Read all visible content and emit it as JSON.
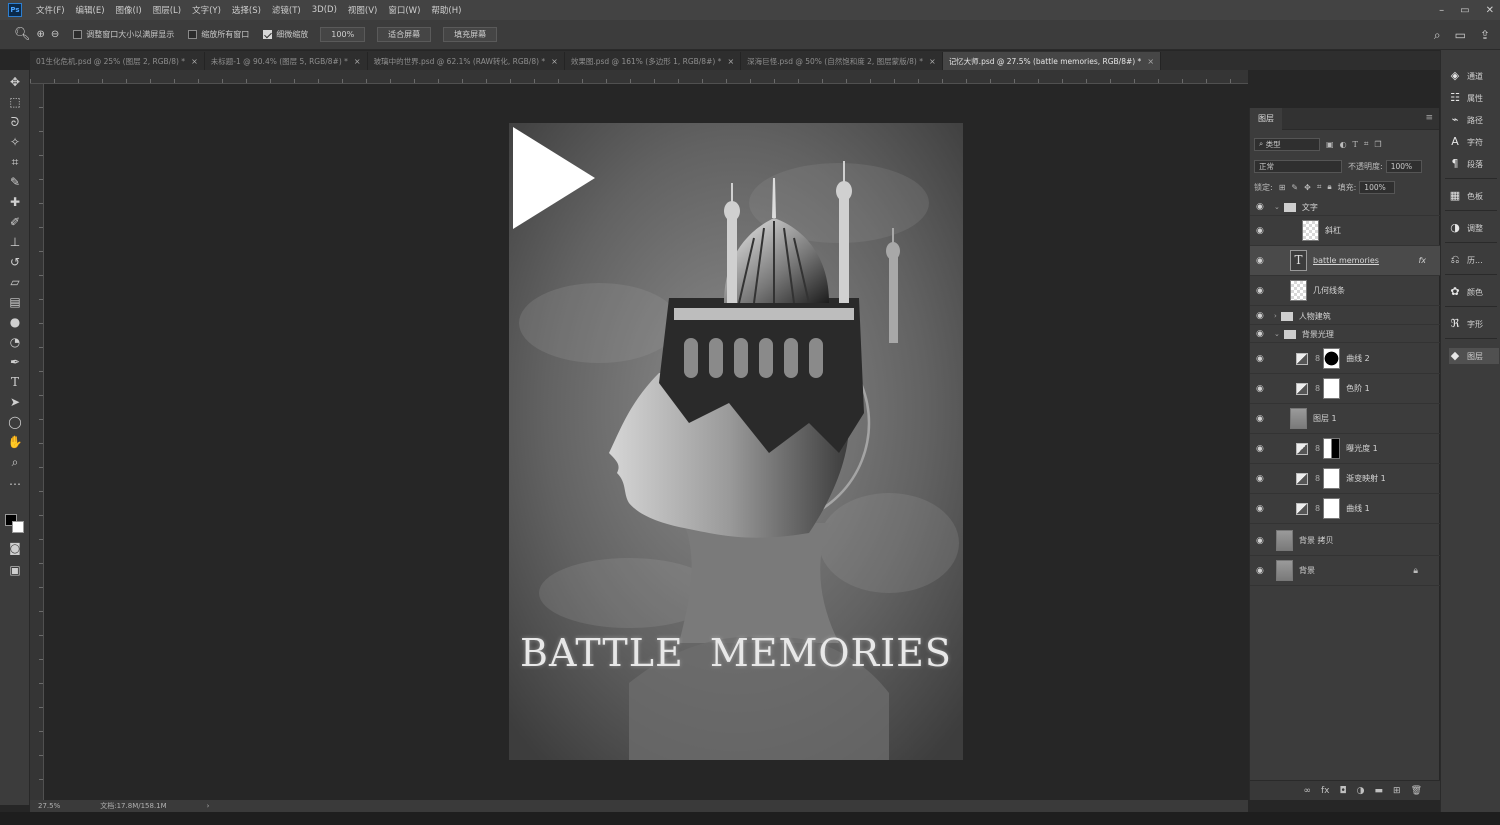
{
  "app": {
    "logo": "Ps",
    "menu": [
      "文件(F)",
      "编辑(E)",
      "图像(I)",
      "图层(L)",
      "文字(Y)",
      "选择(S)",
      "滤镜(T)",
      "3D(D)",
      "视图(V)",
      "窗口(W)",
      "帮助(H)"
    ],
    "window_controls": [
      "–",
      "▭",
      "✕"
    ]
  },
  "options_bar": {
    "tool_icon": "zoom-icon",
    "checks": [
      {
        "label": "调整窗口大小以满屏显示",
        "checked": false
      },
      {
        "label": "缩放所有窗口",
        "checked": false
      },
      {
        "label": "细微缩放",
        "checked": true
      }
    ],
    "zoom_value": "100%",
    "buttons": [
      "适合屏幕",
      "填充屏幕"
    ]
  },
  "tabs": [
    {
      "label": "01生化危机.psd @ 25% (图层 2, RGB/8) *",
      "active": false
    },
    {
      "label": "未标题-1 @ 90.4% (图层 5, RGB/8#) *",
      "active": false
    },
    {
      "label": "玻璃中的世界.psd @ 62.1% (RAW转化, RGB/8) *",
      "active": false
    },
    {
      "label": "效果图.psd @ 161% (多边形 1, RGB/8#) *",
      "active": false
    },
    {
      "label": "深海巨怪.psd @ 50% (自然饱和度 2, 图层蒙版/8) *",
      "active": false
    },
    {
      "label": "记忆大师.psd @ 27.5% (battle  memories, RGB/8#) *",
      "active": true
    }
  ],
  "canvas": {
    "poster_title": "BATTLE  MEMORIES"
  },
  "status": {
    "zoom": "27.5%",
    "doc": "文档:17.8M/158.1M"
  },
  "layers_panel": {
    "tab": "图层",
    "filter_kind": "类型",
    "blend_mode": "正常",
    "opacity_label": "不透明度:",
    "opacity_value": "100%",
    "lock_label": "锁定:",
    "fill_label": "填充:",
    "fill_value": "100%",
    "layers": [
      {
        "name": "文字",
        "kind": "group",
        "open": true
      },
      {
        "name": "斜杠",
        "kind": "checker"
      },
      {
        "name": "battle  memories",
        "kind": "text",
        "selected": true,
        "fx": true
      },
      {
        "name": "几何线条",
        "kind": "checker"
      },
      {
        "name": "人物建筑",
        "kind": "group",
        "open": false
      },
      {
        "name": "背景光理",
        "kind": "group",
        "open": true
      },
      {
        "name": "曲线 2",
        "kind": "adj-black"
      },
      {
        "name": "色阶 1",
        "kind": "adj-white"
      },
      {
        "name": "图层 1",
        "kind": "gray"
      },
      {
        "name": "曝光度 1",
        "kind": "adj-half"
      },
      {
        "name": "渐变映射 1",
        "kind": "adj-white"
      },
      {
        "name": "曲线 1",
        "kind": "adj-white"
      },
      {
        "name": "背景 拷贝",
        "kind": "gray"
      },
      {
        "name": "背景",
        "kind": "gray",
        "locked": true
      }
    ]
  },
  "dock": [
    {
      "label": "通道",
      "icon": "channels-icon"
    },
    {
      "label": "属性",
      "icon": "properties-icon"
    },
    {
      "label": "路径",
      "icon": "paths-icon"
    },
    {
      "label": "字符",
      "icon": "character-icon"
    },
    {
      "label": "段落",
      "icon": "paragraph-icon"
    },
    {
      "label": "色板",
      "icon": "swatches-icon"
    },
    {
      "label": "调整",
      "icon": "adjustments-icon"
    },
    {
      "label": "历...",
      "icon": "history-icon"
    },
    {
      "label": "颜色",
      "icon": "color-icon"
    },
    {
      "label": "字形",
      "icon": "glyphs-icon"
    },
    {
      "label": "图层",
      "icon": "layers-icon",
      "active": true
    }
  ]
}
